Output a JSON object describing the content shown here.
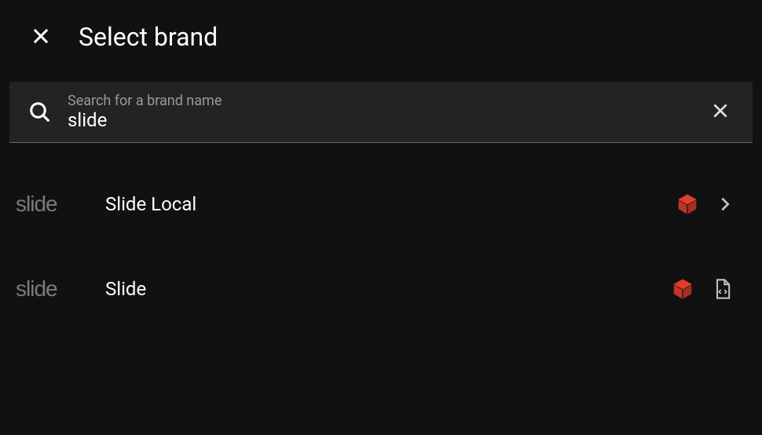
{
  "header": {
    "title": "Select brand"
  },
  "search": {
    "label": "Search for a brand name",
    "value": "slide"
  },
  "results": [
    {
      "logo_text": "slide",
      "name": "Slide Local",
      "has_box": true,
      "has_chevron": true,
      "has_code_file": false
    },
    {
      "logo_text": "slide",
      "name": "Slide",
      "has_box": true,
      "has_chevron": false,
      "has_code_file": true
    }
  ]
}
